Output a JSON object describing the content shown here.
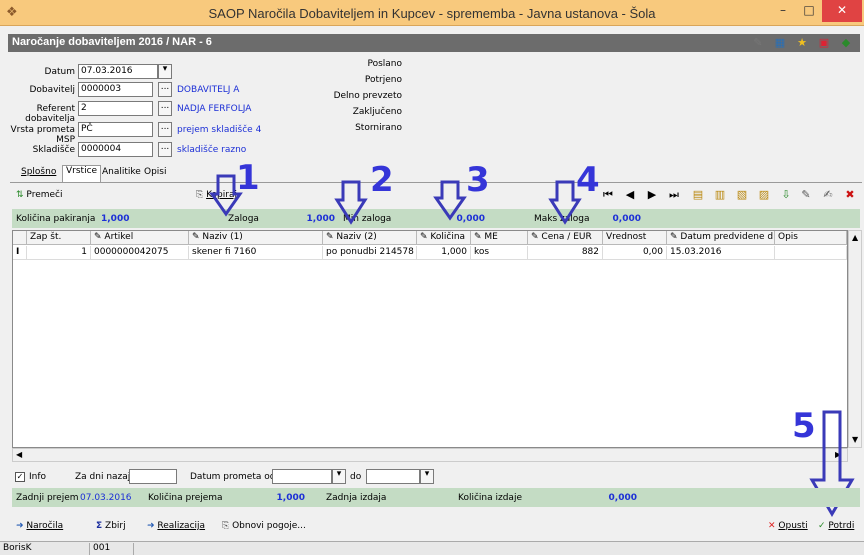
{
  "window": {
    "title": "SAOP  Naročila Dobaviteljem in Kupcev - sprememba - Javna ustanova - Šola",
    "minimize": "–",
    "maximize": "□",
    "close": "✕"
  },
  "form": {
    "title": "Naročanje dobaviteljem 2016 / NAR - 6"
  },
  "header": {
    "datum_label": "Datum",
    "datum_value": "07.03.2016",
    "dobavitelj_label": "Dobavitelj",
    "dobavitelj_value": "0000003",
    "dobavitelj_name": "DOBAVITELJ  A",
    "referent_label": "Referent dobavitelja",
    "referent_value": "2",
    "referent_name": "NADJA FERFOLJA",
    "vrsta_label": "Vrsta prometa MSP",
    "vrsta_value": "PČ",
    "vrsta_name": "prejem skladišče 4",
    "skladisce_label": "Skladišče",
    "skladisce_value": "0000004",
    "skladisce_name": "skladišče razno",
    "dots": "...",
    "status": [
      "Poslano",
      "Potrjeno",
      "Delno prevzeto",
      "Zaključeno",
      "Stornirano"
    ]
  },
  "tabs": [
    "Splošno",
    "Vrstice",
    "Analitike",
    "Opisi"
  ],
  "toolbar": {
    "premeci": "Premeči",
    "kopiraj": "Kopiraj"
  },
  "summary": {
    "kolicina_pakiranja_label": "Količina pakiranja",
    "kolicina_pakiranja_value": "1,000",
    "zaloga_label": "Zaloga",
    "zaloga_value": "1,000",
    "min_zaloga_label": "Min zaloga",
    "min_zaloga_value": "0,000",
    "maks_zaloga_label": "Maks zaloga",
    "maks_zaloga_value": "0,000"
  },
  "grid": {
    "columns": [
      "Zap št.",
      "Artikel",
      "Naziv (1)",
      "Naziv (2)",
      "Količina",
      "ME",
      "Cena / EUR",
      "Vrednost",
      "Datum predvidene d...",
      "Opis"
    ],
    "rows": [
      {
        "marker": "I",
        "zap": "1",
        "artikel": "0000000042075",
        "naziv1": "skener  fi 7160",
        "naziv2": "po ponudbi 214578",
        "kolicina": "1,000",
        "me": "kos",
        "cena": "882",
        "vrednost": "0,00",
        "datum": "15.03.2016",
        "opis": ""
      }
    ]
  },
  "annotations": [
    "1",
    "2",
    "3",
    "4",
    "5"
  ],
  "filter": {
    "info_label": "Info",
    "za_dni_nazaj_label": "Za dni nazaj",
    "datum_prometa_od_label": "Datum prometa od",
    "do_label": "do"
  },
  "footer_summary": {
    "zadnji_prejem_label": "Zadnji prejem",
    "zadnji_prejem_value": "07.03.2016",
    "kolicina_prejema_label": "Količina prejema",
    "kolicina_prejema_value": "1,000",
    "zadnja_izdaja_label": "Zadnja izdaja",
    "kolicina_izdaje_label": "Količina izdaje",
    "kolicina_izdaje_value": "0,000"
  },
  "bottom_buttons": {
    "narocila": "Naročila",
    "zbirj": "Zbirj",
    "realizacija": "Realizacija",
    "obnovi": "Obnovi pogoje...",
    "opusti": "Opusti",
    "potrdi": "Potrdi"
  },
  "statusbar": {
    "user": "BorisK",
    "code": "001"
  },
  "colors": {
    "titlebar": "#f8c97d",
    "formheader": "#6c6c6c",
    "summary_green": "#c4dcc4",
    "link_blue": "#1c2fd6",
    "annotation_blue": "#3535d8"
  }
}
